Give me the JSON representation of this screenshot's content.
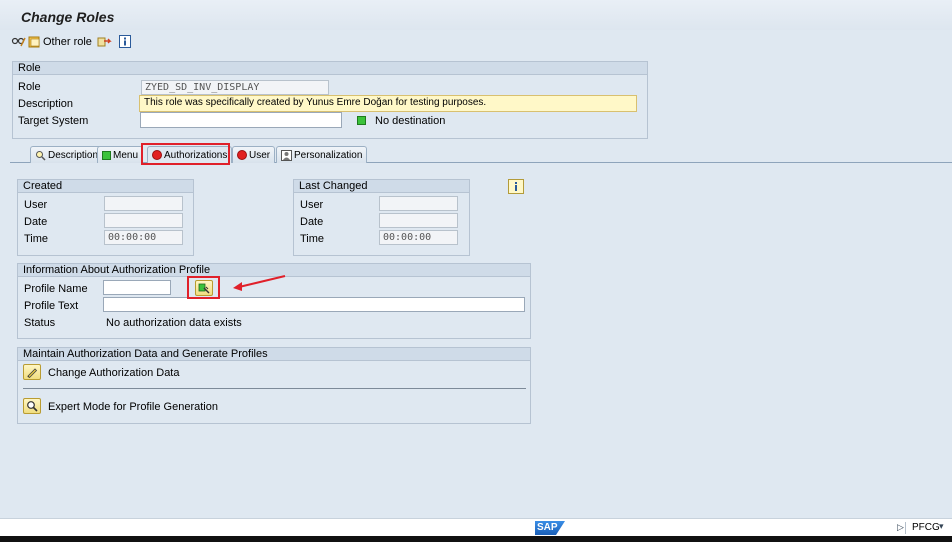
{
  "window": {
    "title": "Change Roles"
  },
  "toolbar": {
    "other_role": "Other role"
  },
  "role_box": {
    "title": "Role",
    "role_label": "Role",
    "role_value": "ZYED_SD_INV_DISPLAY",
    "description_label": "Description",
    "description_value": "This role was specifically created by Yunus Emre Doğan for testing purposes.",
    "target_system_label": "Target System",
    "target_system_value": "",
    "destination_status": "No destination"
  },
  "tabs": [
    {
      "label": "Description"
    },
    {
      "label": "Menu"
    },
    {
      "label": "Authorizations"
    },
    {
      "label": "User"
    },
    {
      "label": "Personalization"
    }
  ],
  "created": {
    "title": "Created",
    "user_label": "User",
    "user_value": "",
    "date_label": "Date",
    "date_value": "",
    "time_label": "Time",
    "time_value": "00:00:00"
  },
  "last_changed": {
    "title": "Last Changed",
    "user_label": "User",
    "user_value": "",
    "date_label": "Date",
    "date_value": "",
    "time_label": "Time",
    "time_value": "00:00:00"
  },
  "auth_profile": {
    "title": "Information About Authorization Profile",
    "profile_name_label": "Profile Name",
    "profile_name_value": "",
    "profile_text_label": "Profile Text",
    "profile_text_value": "",
    "status_label": "Status",
    "status_value": "No authorization data exists"
  },
  "maintain": {
    "title": "Maintain Authorization Data and Generate Profiles",
    "change_label": "Change Authorization Data",
    "expert_label": "Expert Mode for Profile Generation"
  },
  "status_bar": {
    "brand": "SAP",
    "transaction": "PFCG"
  },
  "colors": {
    "highlight": "#e0202a",
    "status_red": "#e12020",
    "status_green": "#3bc23b",
    "background": "#dfe8f1"
  }
}
